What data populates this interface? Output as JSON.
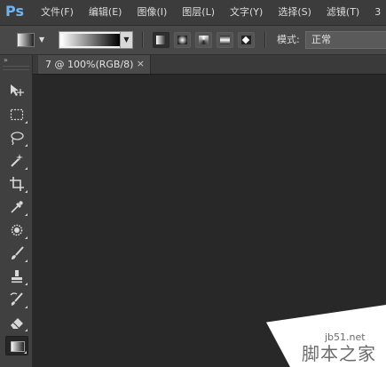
{
  "app": {
    "logo_text": "Ps"
  },
  "menu": {
    "items": [
      {
        "label": "文件(F)"
      },
      {
        "label": "编辑(E)"
      },
      {
        "label": "图像(I)"
      },
      {
        "label": "图层(L)"
      },
      {
        "label": "文字(Y)"
      },
      {
        "label": "选择(S)"
      },
      {
        "label": "滤镜(T)"
      },
      {
        "label": "3"
      }
    ]
  },
  "options_bar": {
    "gradient_types": [
      "linear",
      "radial",
      "angle",
      "reflected",
      "diamond"
    ],
    "selected_gradient_type": "linear",
    "mode_label": "模式:",
    "mode_value": "正常"
  },
  "toolbox": {
    "collapse_glyph": "»",
    "tools": [
      {
        "name": "move-tool"
      },
      {
        "name": "marquee-tool"
      },
      {
        "name": "lasso-tool"
      },
      {
        "name": "magic-wand-tool"
      },
      {
        "name": "crop-tool"
      },
      {
        "name": "eyedropper-tool"
      },
      {
        "name": "healing-brush-tool"
      },
      {
        "name": "brush-tool"
      },
      {
        "name": "clone-stamp-tool"
      },
      {
        "name": "history-brush-tool"
      },
      {
        "name": "eraser-tool"
      },
      {
        "name": "gradient-tool",
        "active": true
      }
    ]
  },
  "document": {
    "tab_title": "7 @ 100%(RGB/8)",
    "close_glyph": "×"
  },
  "watermark": {
    "domain": "jb51.net",
    "text": "脚本之家"
  },
  "colors": {
    "menubar_bg": "#3c3c3c",
    "optbar_bg": "#484848",
    "toolbox_bg": "#404040",
    "canvas_bg": "#282828",
    "logo": "#6fb4f2"
  }
}
